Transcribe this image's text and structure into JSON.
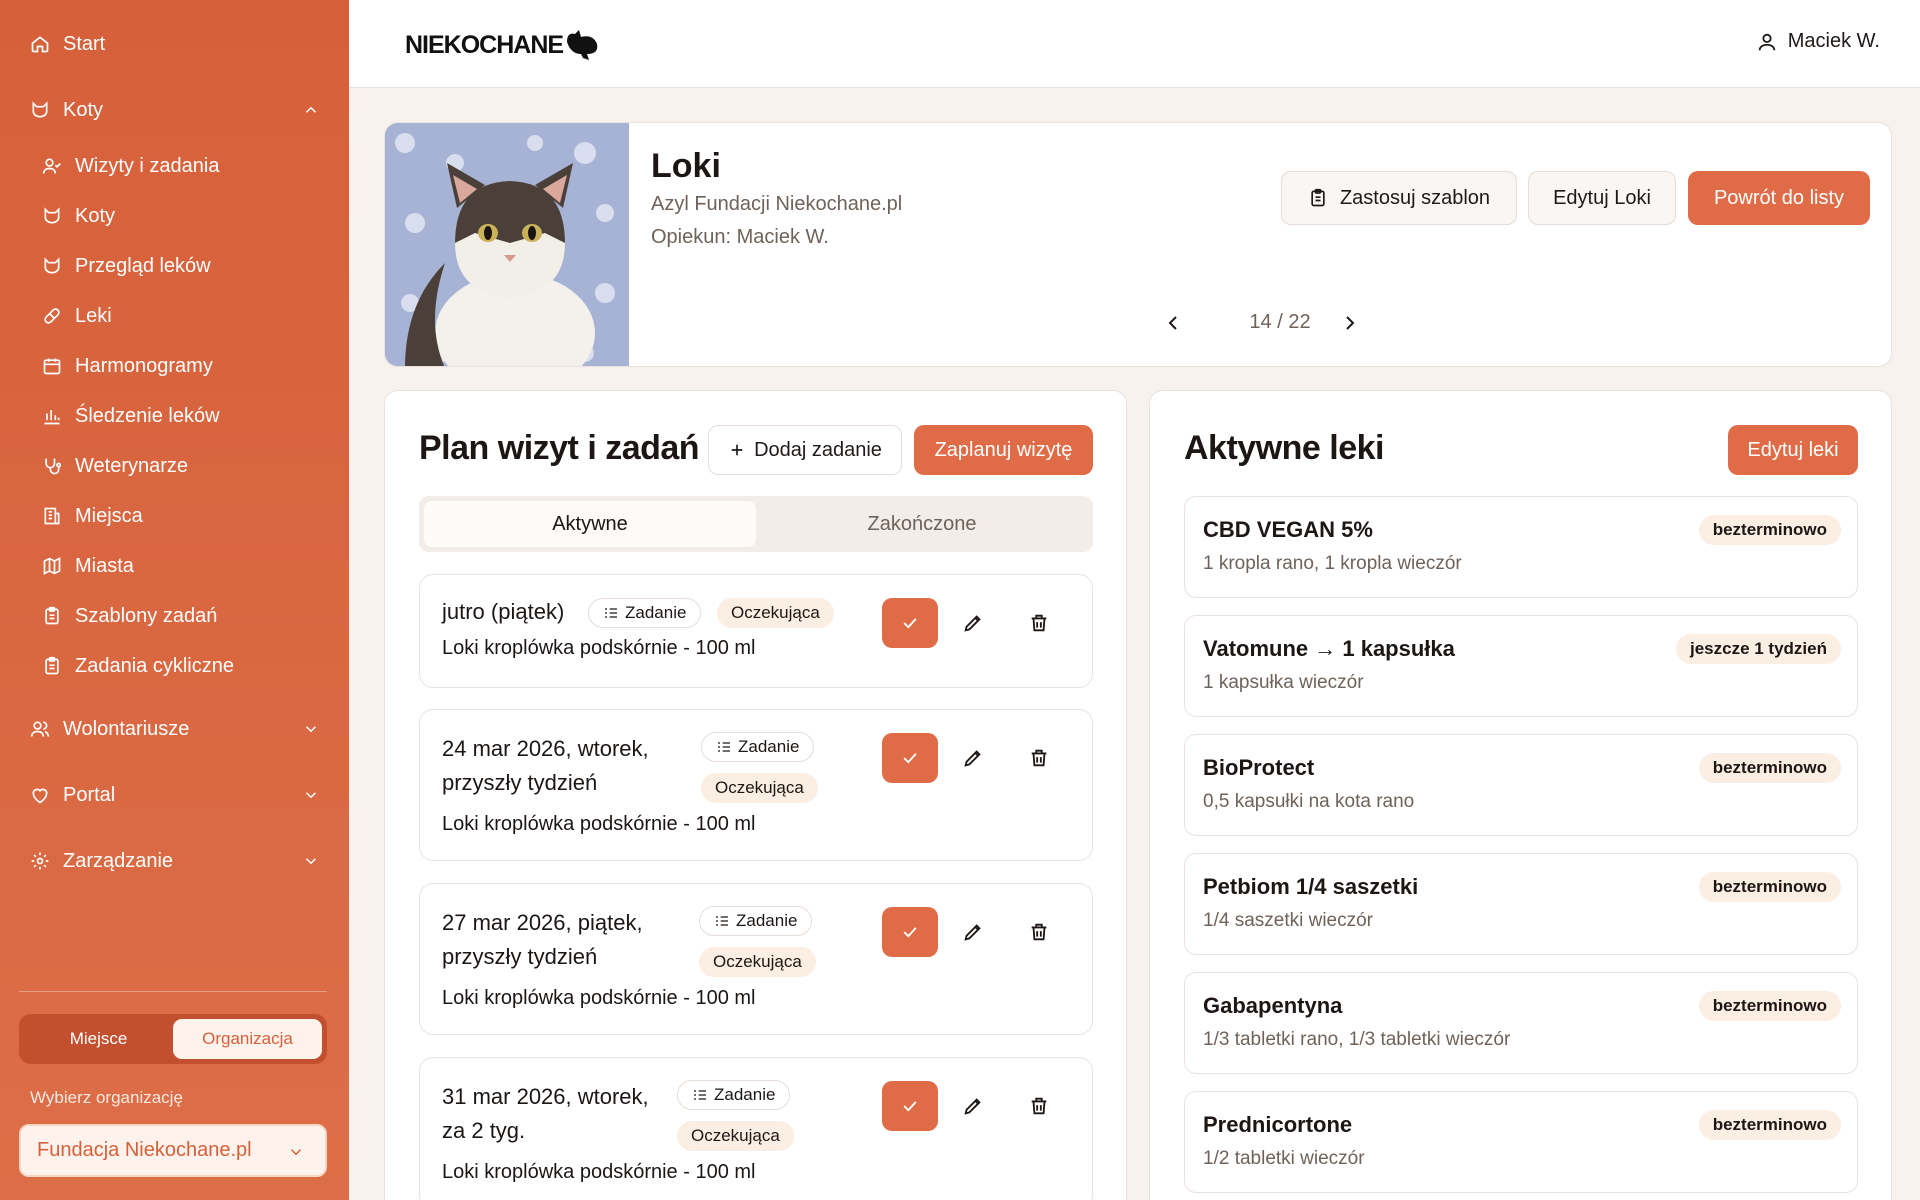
{
  "sidebar": {
    "start": "Start",
    "koty_section": "Koty",
    "sub_items": [
      "Wizyty i zadania",
      "Koty",
      "Przegląd leków",
      "Leki",
      "Harmonogramy",
      "Śledzenie leków",
      "Weterynarze",
      "Miejsca",
      "Miasta",
      "Szablony zadań",
      "Zadania cykliczne"
    ],
    "wolontariusze": "Wolontariusze",
    "portal": "Portal",
    "zarzadzanie": "Zarządzanie",
    "segment": {
      "option1": "Miejsce",
      "option2": "Organizacja",
      "active": "Organizacja"
    },
    "org_label": "Wybierz organizację",
    "org_value": "Fundacja Niekochane.pl"
  },
  "header": {
    "logo": "NIEKOCHANE",
    "user": "Maciek W."
  },
  "cat": {
    "name": "Loki",
    "location": "Azyl Fundacji Niekochane.pl",
    "caretaker": "Opiekun: Maciek W.",
    "apply_template": "Zastosuj szablon",
    "edit": "Edytuj Loki",
    "back": "Powrót do listy",
    "pager": "14 / 22"
  },
  "plan": {
    "title": "Plan wizyt i zadań",
    "add_task": "Dodaj zadanie",
    "schedule_visit": "Zaplanuj wizytę",
    "tab_active": "Aktywne",
    "tab_done": "Zakończone",
    "tasks": [
      {
        "date1": "jutro (piątek)",
        "date2": "",
        "type": "Zadanie",
        "status": "Oczekująca",
        "desc": "Loki kroplówka podskórnie - 100 ml"
      },
      {
        "date1": "24 mar 2026, wtorek,",
        "date2": "przyszły tydzień",
        "type": "Zadanie",
        "status": "Oczekująca",
        "desc": "Loki kroplówka podskórnie - 100 ml"
      },
      {
        "date1": "27 mar 2026, piątek,",
        "date2": "przyszły tydzień",
        "type": "Zadanie",
        "status": "Oczekująca",
        "desc": "Loki kroplówka podskórnie - 100 ml"
      },
      {
        "date1": "31 mar 2026, wtorek,",
        "date2": "za 2 tyg.",
        "type": "Zadanie",
        "status": "Oczekująca",
        "desc": "Loki kroplówka podskórnie - 100 ml"
      }
    ]
  },
  "meds": {
    "title": "Aktywne leki",
    "edit": "Edytuj leki",
    "items": [
      {
        "name": "CBD VEGAN 5%",
        "dose": "1 kropla rano, 1 kropla wieczór",
        "badge": "bezterminowo"
      },
      {
        "name": "Vatomune → 1 kapsułka",
        "dose": "1 kapsułka wieczór",
        "badge": "jeszcze 1 tydzień"
      },
      {
        "name": "BioProtect",
        "dose": "0,5 kapsułki na kota rano",
        "badge": "bezterminowo"
      },
      {
        "name": "Petbiom 1/4 saszetki",
        "dose": "1/4 saszetki wieczór",
        "badge": "bezterminowo"
      },
      {
        "name": "Gabapentyna",
        "dose": "1/3 tabletki rano, 1/3 tabletki wieczór",
        "badge": "bezterminowo"
      },
      {
        "name": "Prednicortone",
        "dose": "1/2 tabletki wieczór",
        "badge": "bezterminowo"
      }
    ]
  }
}
